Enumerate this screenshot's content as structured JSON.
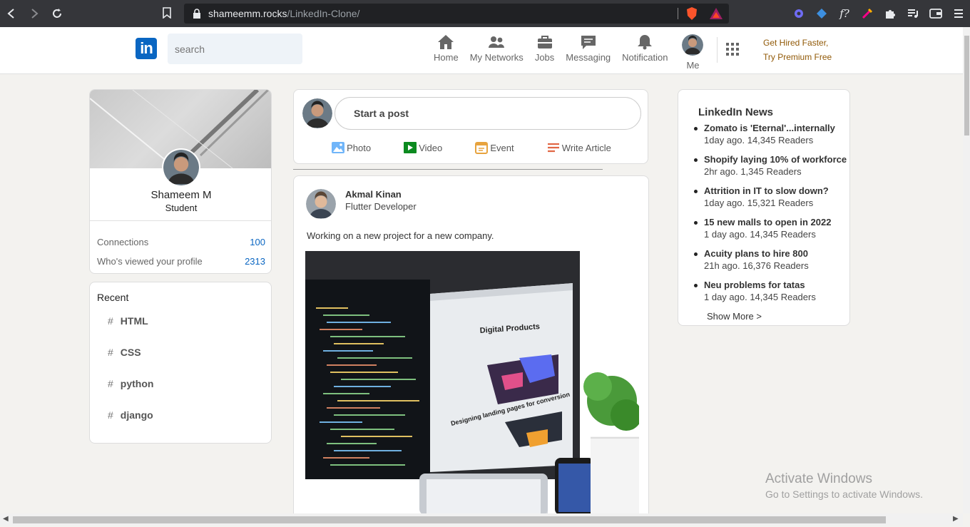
{
  "browser": {
    "url_host": "shameemm.rocks",
    "url_path": "/LinkedIn-Clone/"
  },
  "nav": {
    "logo": "in",
    "search_placeholder": "search",
    "items": [
      {
        "label": "Home",
        "icon": "home-icon"
      },
      {
        "label": "My Networks",
        "icon": "people-icon"
      },
      {
        "label": "Jobs",
        "icon": "briefcase-icon"
      },
      {
        "label": "Messaging",
        "icon": "chat-icon"
      },
      {
        "label": "Notification",
        "icon": "bell-icon"
      }
    ],
    "me_label": "Me",
    "premium_line1": "Get Hired Faster,",
    "premium_line2": "Try Premium Free"
  },
  "profile": {
    "name": "Shameem M",
    "title": "Student",
    "connections_label": "Connections",
    "connections_value": "100",
    "views_label": "Who's viewed your profile",
    "views_value": "2313"
  },
  "recent": {
    "title": "Recent",
    "tags": [
      "HTML",
      "CSS",
      "python",
      "django"
    ]
  },
  "composer": {
    "placeholder": "Start a post",
    "actions": [
      {
        "label": "Photo",
        "icon": "photo-icon"
      },
      {
        "label": "Video",
        "icon": "video-icon"
      },
      {
        "label": "Event",
        "icon": "calendar-icon"
      },
      {
        "label": "Write Article",
        "icon": "article-icon"
      }
    ]
  },
  "post": {
    "author": "Akmal Kinan",
    "role": "Flutter Developer",
    "text": "Working on a new project for a new company.",
    "image_heading": "Digital Products",
    "image_subheading": "Designing landing pages for conversion"
  },
  "news": {
    "title": "LinkedIn News",
    "items": [
      {
        "headline": "Zomato is 'Eternal'...internally",
        "meta": "1day ago. 14,345 Readers"
      },
      {
        "headline": "Shopify laying 10% of workforce",
        "meta": "2hr ago. 1,345 Readers"
      },
      {
        "headline": "Attrition in IT to slow down?",
        "meta": "1day ago. 15,321 Readers"
      },
      {
        "headline": "15 new malls to open in 2022",
        "meta": "1 day ago. 14,345 Readers"
      },
      {
        "headline": "Acuity plans to hire 800",
        "meta": "21h ago. 16,376 Readers"
      },
      {
        "headline": "Neu problems for tatas",
        "meta": "1 day ago. 14,345 Readers"
      }
    ],
    "show_more": "Show More >"
  },
  "watermark": {
    "line1": "Activate Windows",
    "line2": "Go to Settings to activate Windows."
  },
  "colors": {
    "brand": "#0a66c2",
    "premium": "#915907",
    "background": "#f3f2ef"
  }
}
